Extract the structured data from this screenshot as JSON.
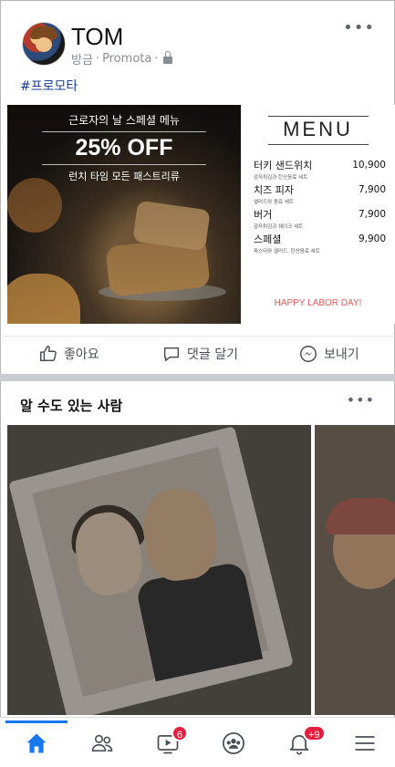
{
  "post": {
    "author": "TOM",
    "time": "방금",
    "separator1": "·",
    "source": "Promota",
    "separator2": "·",
    "hashtag": "#프로모타"
  },
  "ad": {
    "promo_subtitle": "근로자의 날 스페셜 메뉴",
    "promo_main": "25% OFF",
    "promo_footer": "런치 타임 모든 패스트리류",
    "menu_title": "MENU",
    "menu_items": [
      {
        "name": "터키 샌드위치",
        "desc": "감자튀김과 탄산음료 세트",
        "price": "10,900"
      },
      {
        "name": "치즈 피자",
        "desc": "샐러드와 음료 세트",
        "price": "7,900"
      },
      {
        "name": "버거",
        "desc": "감자튀김과 쉐이크 세트",
        "price": "7,900"
      },
      {
        "name": "스페셜",
        "desc": "파스타와 샐러드, 탄산음료 세트",
        "price": "9,900"
      }
    ],
    "footer": "HAPPY LABOR DAY!"
  },
  "actions": {
    "like": "좋아요",
    "comment": "댓글 달기",
    "share": "보내기"
  },
  "pymk": {
    "title": "알 수도 있는 사람"
  },
  "nav": {
    "video_badge": "6",
    "notifications_badge": "+9"
  },
  "colors": {
    "accent": "#1877f2",
    "badge": "#e41e3f",
    "hashtag": "#1b3f9b",
    "promo_footer": "#e45a5a"
  },
  "icons": {
    "nav": [
      "home-icon",
      "friends-icon",
      "video-icon",
      "groups-icon",
      "notifications-icon",
      "menu-icon"
    ]
  }
}
